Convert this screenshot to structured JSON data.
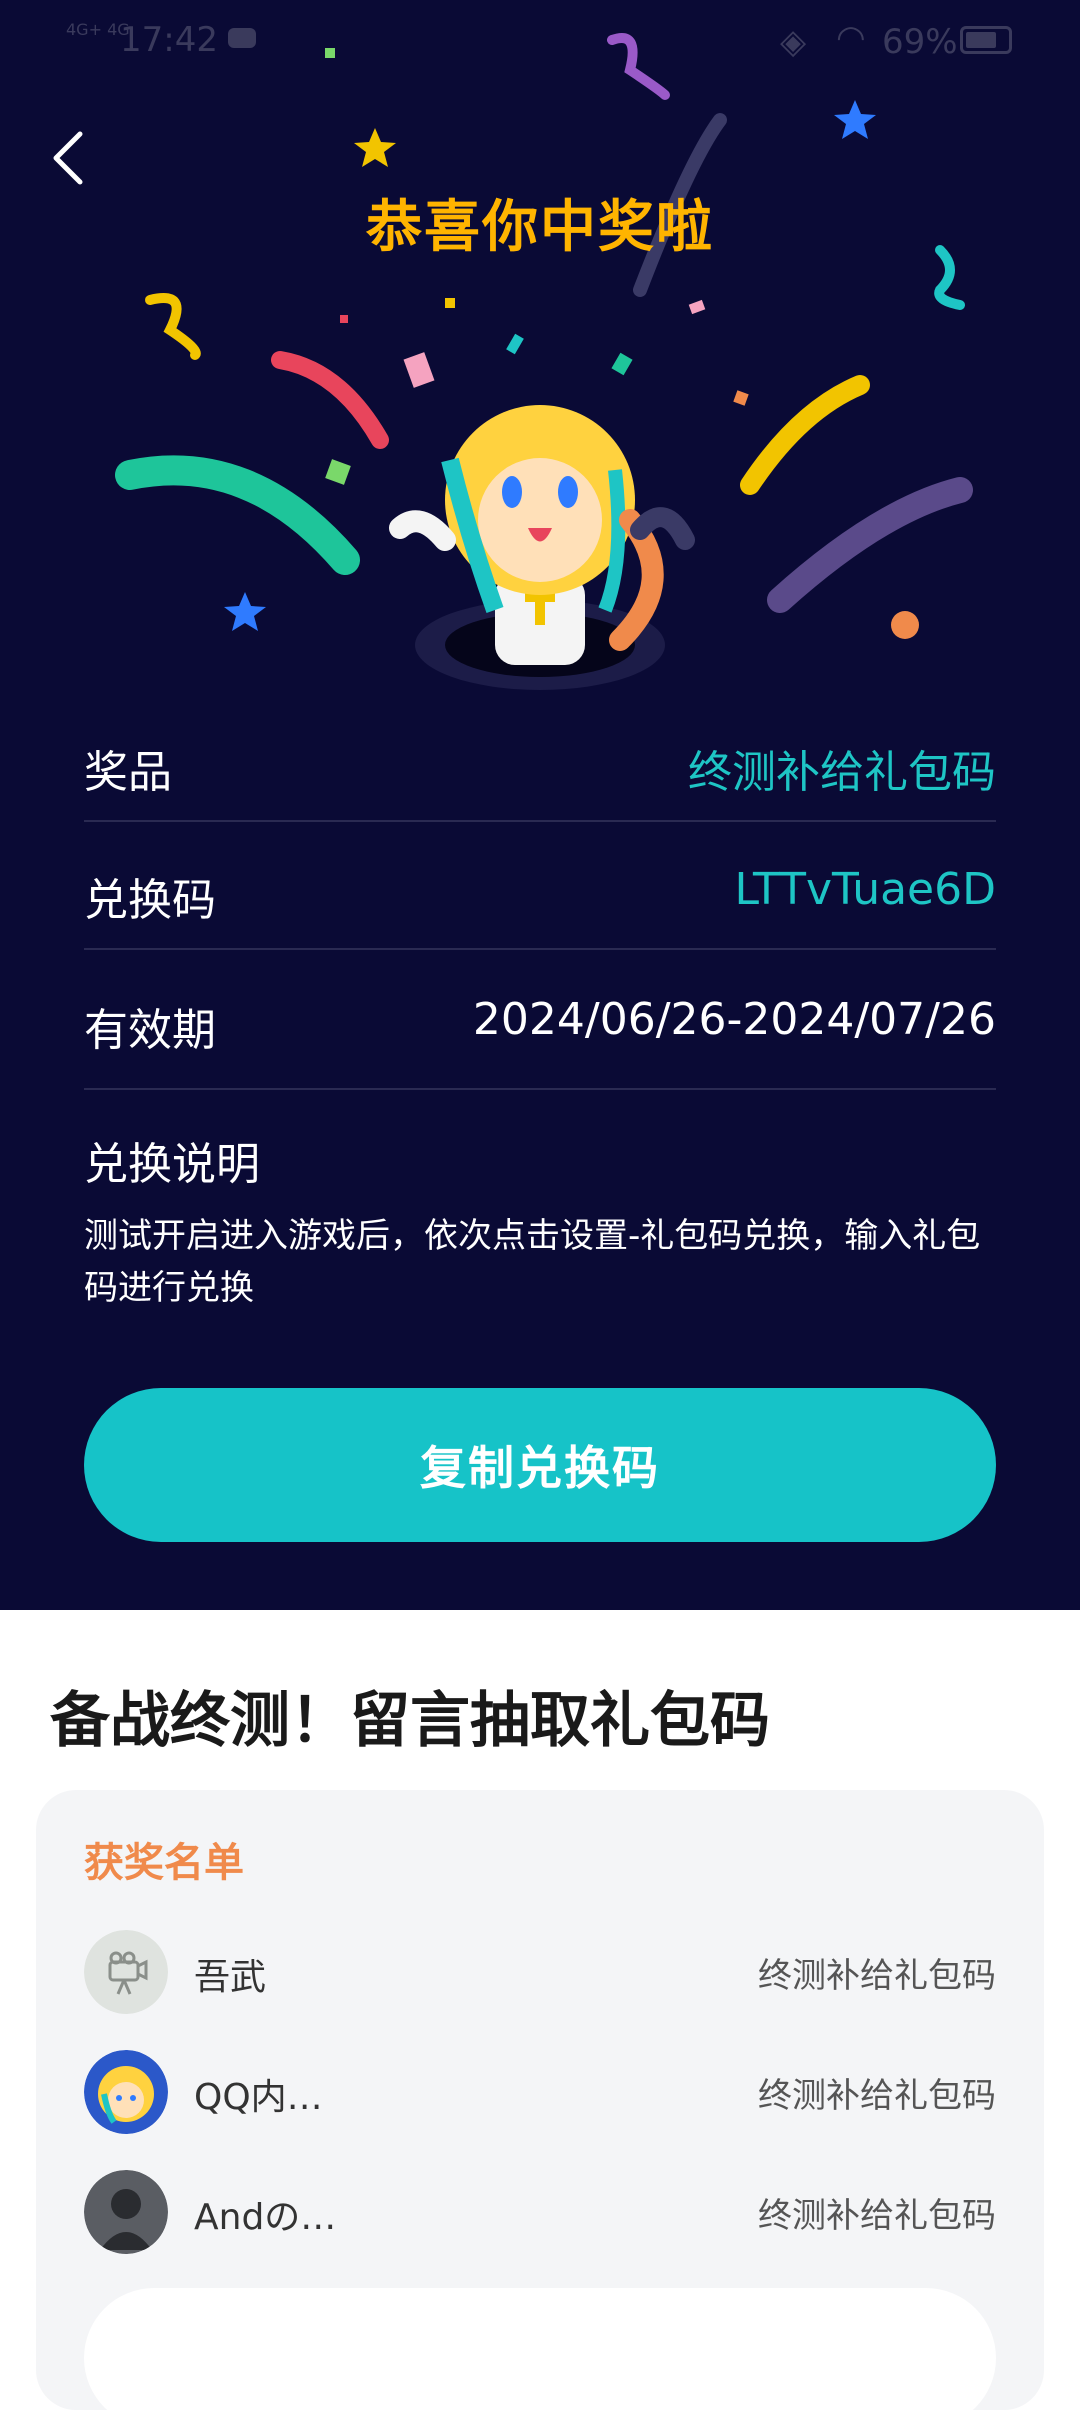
{
  "status_bar": {
    "time": "17:42",
    "network": "4G+ 4G",
    "battery": "69%"
  },
  "page": {
    "title": "恭喜你中奖啦"
  },
  "prize_info": {
    "prize_label": "奖品",
    "prize_value": "终测补给礼包码",
    "code_label": "兑换码",
    "code_value": "LTTvTuae6D",
    "validity_label": "有效期",
    "validity_value": "2024/06/26-2024/07/26",
    "instructions_title": "兑换说明",
    "instructions_text": "测试开启进入游戏后，依次点击设置-礼包码兑换，输入礼包码进行兑换"
  },
  "copy_button": {
    "label": "复制兑换码"
  },
  "event": {
    "title": "备战终测！留言抽取礼包码",
    "winners_title": "获奖名单",
    "winners": [
      {
        "name": "吾武",
        "prize": "终测补给礼包码"
      },
      {
        "name": "QQ内…",
        "prize": "终测补给礼包码"
      },
      {
        "name": "Andの…",
        "prize": "终测补给礼包码"
      }
    ]
  },
  "colors": {
    "background_dark": "#0a0a35",
    "accent_teal": "#16c3c8",
    "title_yellow": "#ffb400",
    "winners_orange": "#f08a4b"
  },
  "icons": {
    "back": "back-arrow-icon"
  }
}
